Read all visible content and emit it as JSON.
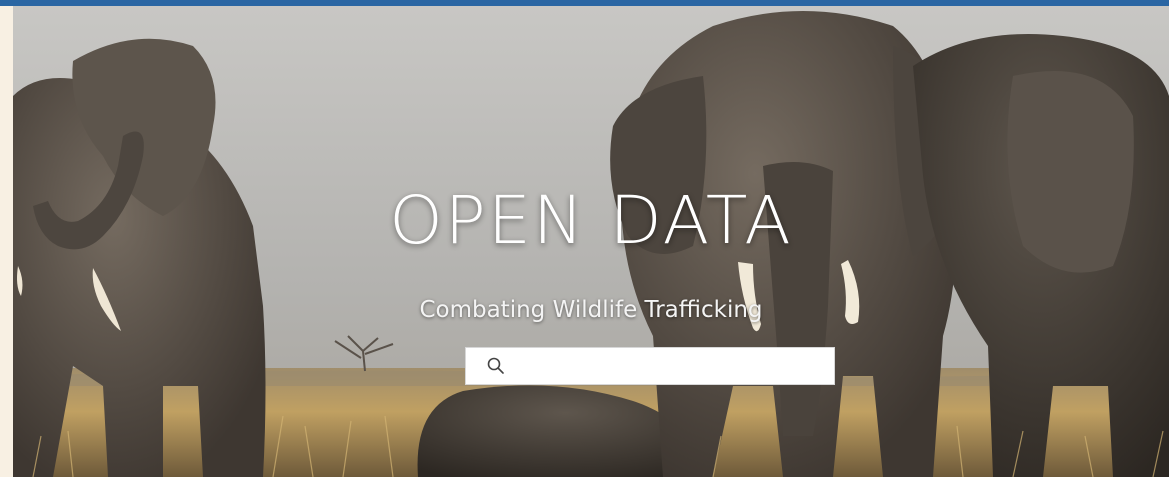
{
  "hero": {
    "title": "OPEN DATA",
    "subtitle": "Combating Wildlife Trafficking",
    "background_image": "elephants-savanna"
  },
  "search": {
    "placeholder": "",
    "icon": "search-icon"
  },
  "colors": {
    "top_bar": "#2a66a3",
    "sky": "#b6b6b4",
    "grass": "#b99a5a",
    "elephant": "#5a524a"
  }
}
